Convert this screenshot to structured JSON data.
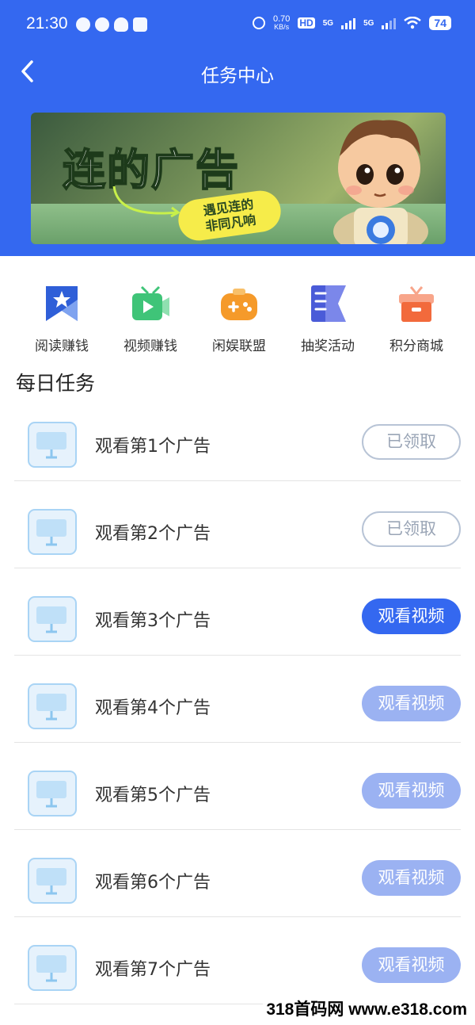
{
  "status_bar": {
    "time": "21:30",
    "net_speed_value": "0.70",
    "net_speed_unit": "KB/s",
    "hd_label": "HD",
    "signal1_label": "5G",
    "signal2_label": "5G",
    "battery": "74"
  },
  "nav": {
    "title": "任务中心",
    "back_icon": "chevron-left-icon"
  },
  "banner": {
    "title": "连的广告",
    "tag_line1": "遇见连的",
    "tag_line2": "非同凡响"
  },
  "quick_links": [
    {
      "label": "阅读赚钱",
      "icon": "book-star-icon",
      "color": "#2f5fd8"
    },
    {
      "label": "视频赚钱",
      "icon": "video-play-icon",
      "color": "#3fc478"
    },
    {
      "label": "闲娱联盟",
      "icon": "gamepad-icon",
      "color": "#f59a2a"
    },
    {
      "label": "抽奖活动",
      "icon": "bookmark-flag-icon",
      "color": "#4a5bd8"
    },
    {
      "label": "积分商城",
      "icon": "gift-box-icon",
      "color": "#f26a3c"
    }
  ],
  "section_title": "每日任务",
  "tasks": [
    {
      "name": "观看第1个广告",
      "button": "已领取",
      "state": "claimed"
    },
    {
      "name": "观看第2个广告",
      "button": "已领取",
      "state": "claimed"
    },
    {
      "name": "观看第3个广告",
      "button": "观看视频",
      "state": "active"
    },
    {
      "name": "观看第4个广告",
      "button": "观看视频",
      "state": "disabled"
    },
    {
      "name": "观看第5个广告",
      "button": "观看视频",
      "state": "disabled"
    },
    {
      "name": "观看第6个广告",
      "button": "观看视频",
      "state": "disabled"
    },
    {
      "name": "观看第7个广告",
      "button": "观看视频",
      "state": "disabled"
    }
  ],
  "watermark": "318首码网 www.e318.com",
  "colors": {
    "primary": "#3468f0",
    "disabled": "#9bb2f2",
    "claimed_border": "#b8c4d6"
  }
}
